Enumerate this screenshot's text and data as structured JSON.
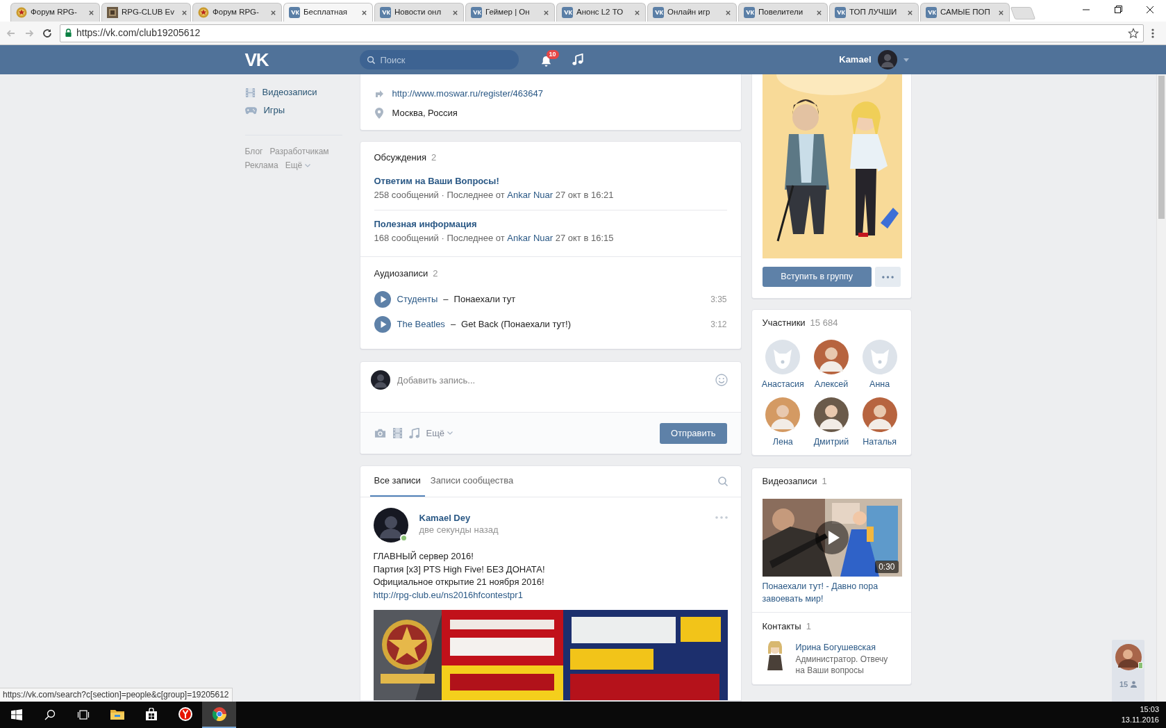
{
  "browser": {
    "tabs": [
      {
        "title": "Форум RPG-",
        "kind": "emblem",
        "selected": false
      },
      {
        "title": "RPG-CLUB Ev",
        "kind": "square",
        "selected": false
      },
      {
        "title": "Форум RPG-",
        "kind": "emblem",
        "selected": false
      },
      {
        "title": "Бесплатная",
        "kind": "vk",
        "selected": true
      },
      {
        "title": "Новости онл",
        "kind": "vk",
        "selected": false
      },
      {
        "title": "Геймер | Он",
        "kind": "vk",
        "selected": false
      },
      {
        "title": "Анонс L2 ТО",
        "kind": "vk",
        "selected": false
      },
      {
        "title": "Онлайн игр",
        "kind": "vk",
        "selected": false
      },
      {
        "title": "Повелители",
        "kind": "vk",
        "selected": false
      },
      {
        "title": "ТОП ЛУЧШИ",
        "kind": "vk",
        "selected": false
      },
      {
        "title": "САМЫЕ ПОП",
        "kind": "vk",
        "selected": false
      }
    ],
    "url": "https://vk.com/club19205612"
  },
  "header": {
    "logo": "VK",
    "search_placeholder": "Поиск",
    "notifications": "10",
    "user": "Kamael"
  },
  "sidebar": {
    "items": [
      {
        "label": "Видеозаписи",
        "kind": "film"
      },
      {
        "label": "Игры",
        "kind": "gamepad"
      }
    ],
    "footer_links": [
      [
        "Блог",
        "Разработчикам"
      ],
      [
        "Реклама",
        "Ещё"
      ]
    ]
  },
  "info": [
    {
      "kind": "link",
      "text": "http://www.moswar.ru/register/463647"
    },
    {
      "kind": "place",
      "text": "Москва, Россия"
    }
  ],
  "discussions": {
    "title": "Обсуждения",
    "count": "2",
    "topics": [
      {
        "title": "Ответим на Ваши Вопросы!",
        "meta_before": "258 сообщений · Последнее от",
        "author": "Ankar Nuar",
        "date": "27 окт в 16:21"
      },
      {
        "title": "Полезная информация",
        "meta_before": "168 сообщений · Последнее от",
        "author": "Ankar Nuar",
        "date": "27 окт в 16:15"
      }
    ]
  },
  "audio": {
    "title": "Аудиозаписи",
    "count": "2",
    "separator": "–",
    "tracks": [
      {
        "artist": "Студенты",
        "title": "Понаехали тут",
        "duration": "3:35"
      },
      {
        "artist": "The Beatles",
        "title": "Get Back (Понаехали тут!)",
        "duration": "3:12"
      }
    ]
  },
  "composer": {
    "placeholder": "Добавить запись...",
    "more": "Ещё",
    "send": "Отправить"
  },
  "wall": {
    "tabs": [
      {
        "label": "Все записи",
        "selected": true
      },
      {
        "label": "Записи сообщества",
        "selected": false
      }
    ],
    "post": {
      "author": "Kamael Dey",
      "time": "две секунды назад",
      "online": true,
      "lines": [
        "ГЛАВНЫЙ сервер 2016!",
        "Партия [x3] PTS High Five! БЕЗ ДОНАТА!",
        "Официальное открытие 21 ноября 2016!"
      ],
      "link": "http://rpg-club.eu/ns2016hfcontestpr1",
      "image": {
        "kind": "picture"
      }
    }
  },
  "group": {
    "image": {
      "kind": "picture"
    },
    "join": "Вступить в группу"
  },
  "members": {
    "title": "Участники",
    "count": "15 684",
    "people": [
      {
        "name": "Анастасия",
        "kind": "default"
      },
      {
        "name": "Алексей"
      },
      {
        "name": "Анна",
        "kind": "default"
      },
      {
        "name": "Лена"
      },
      {
        "name": "Дмитрий"
      },
      {
        "name": "Наталья"
      }
    ]
  },
  "videos": {
    "title": "Видеозаписи",
    "count": "1",
    "items": [
      {
        "duration": "0:30",
        "title": "Понаехали тут! - Давно пора завоевать мир!"
      }
    ]
  },
  "contacts": {
    "title": "Контакты",
    "count": "1",
    "people": [
      {
        "name": "Ирина Богушевская",
        "role": "Администратор. Отвечу на Ваши вопросы"
      }
    ]
  },
  "chat_widget": {
    "online_count": "15",
    "online": true
  },
  "status_url": "https://vk.com/search?c[section]=people&c[group]=19205612",
  "taskbar": {
    "apps": [
      {
        "kind": "explorer",
        "selected": false
      },
      {
        "kind": "store",
        "selected": false
      },
      {
        "kind": "yandex",
        "selected": false
      },
      {
        "kind": "chrome",
        "selected": true
      }
    ],
    "time": "15:03",
    "date": "13.11.2016"
  }
}
